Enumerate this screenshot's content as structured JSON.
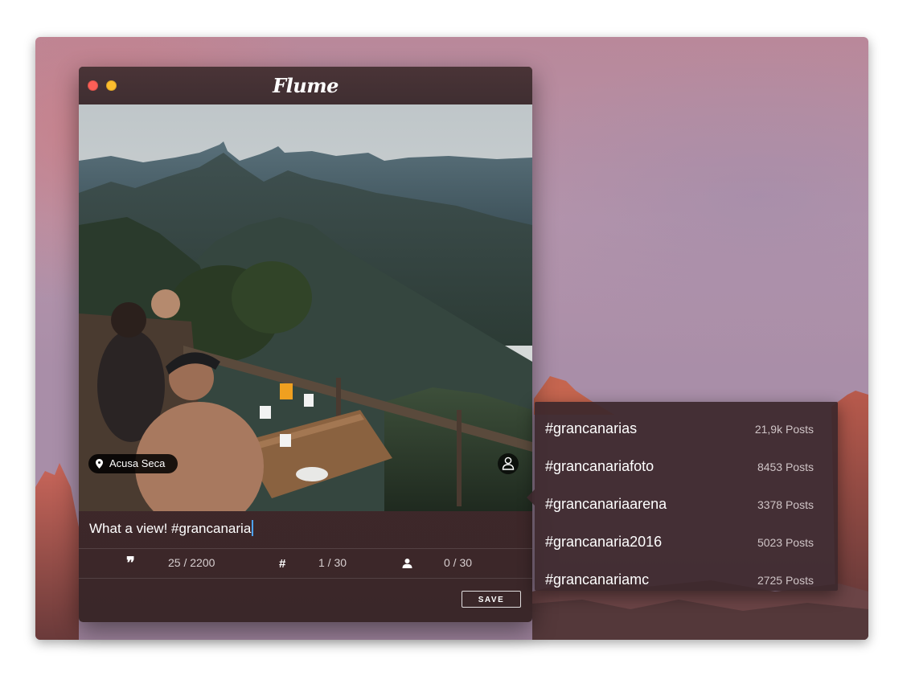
{
  "app": {
    "title": "Flume"
  },
  "post": {
    "location": "Acusa Seca",
    "caption": "What a view! #grancanaria"
  },
  "stats": {
    "characters": "25 / 2200",
    "hashtags": "1 / 30",
    "mentions": "0 / 30"
  },
  "actions": {
    "save_label": "SAVE"
  },
  "suggestions": [
    {
      "tag": "#grancanarias",
      "count": "21,9k Posts"
    },
    {
      "tag": "#grancanariafoto",
      "count": "8453 Posts"
    },
    {
      "tag": "#grancanariaarena",
      "count": "3378 Posts"
    },
    {
      "tag": "#grancanaria2016",
      "count": "5023 Posts"
    },
    {
      "tag": "#grancanariamc",
      "count": "2725 Posts"
    }
  ],
  "icons": {
    "quote": "quote-icon",
    "hashtag": "hashtag-icon",
    "mention": "person-icon",
    "location": "location-pin-icon",
    "tag_people": "tag-people-icon"
  },
  "colors": {
    "close": "#fc5f57",
    "minimize": "#fdbd2e",
    "caret": "#4da3ff"
  }
}
